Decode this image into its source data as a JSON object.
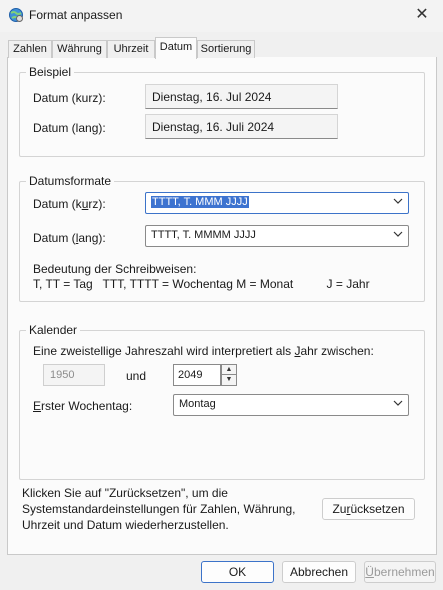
{
  "window": {
    "title": "Format anpassen",
    "close_glyph": "✕",
    "icon": "globe-settings-icon"
  },
  "tabs": [
    {
      "label": "Zahlen"
    },
    {
      "label": "Währung"
    },
    {
      "label": "Uhrzeit"
    },
    {
      "label": "Datum",
      "active": true
    },
    {
      "label": "Sortierung"
    }
  ],
  "example": {
    "legend": "Beispiel",
    "short_label": "Datum (kurz):",
    "short_value": "Dienstag, 16. Jul 2024",
    "long_label": "Datum (lang):",
    "long_value": "Dienstag, 16. Juli 2024"
  },
  "formats": {
    "legend": "Datumsformate",
    "short_label_pre": "Datum (k",
    "short_label_ul": "u",
    "short_label_post": "rz):",
    "short_value": "TTTT, T. MMM JJJJ",
    "long_label_pre": "Datum (",
    "long_label_ul": "l",
    "long_label_post": "ang):",
    "long_value": "TTTT, T. MMMM JJJJ",
    "meaning_title": "Bedeutung der Schreibweisen:",
    "meaning_line": "T, TT = Tag   TTT, TTTT = Wochentag M = Monat          J = Jahr"
  },
  "calendar": {
    "legend": "Kalender",
    "year_text_pre": "Eine zweistellige Jahreszahl wird interpretiert als ",
    "year_text_ul": "J",
    "year_text_post": "ahr zwischen:",
    "from_year": "1950",
    "and_label": "und",
    "to_year": "2049",
    "first_day_label_ul": "E",
    "first_day_label_post": "rster Wochentag:",
    "first_day_value": "Montag"
  },
  "reset": {
    "text": "Klicken Sie auf \"Zurücksetzen\", um die Systemstandardeinstellungen für Zahlen, Währung, Uhrzeit und Datum wiederherzustellen.",
    "button_pre": "Zu",
    "button_ul": "r",
    "button_post": "ücksetzen"
  },
  "footer": {
    "ok": "OK",
    "cancel": "Abbrechen",
    "apply_ul": "Ü",
    "apply_post": "bernehmen"
  }
}
